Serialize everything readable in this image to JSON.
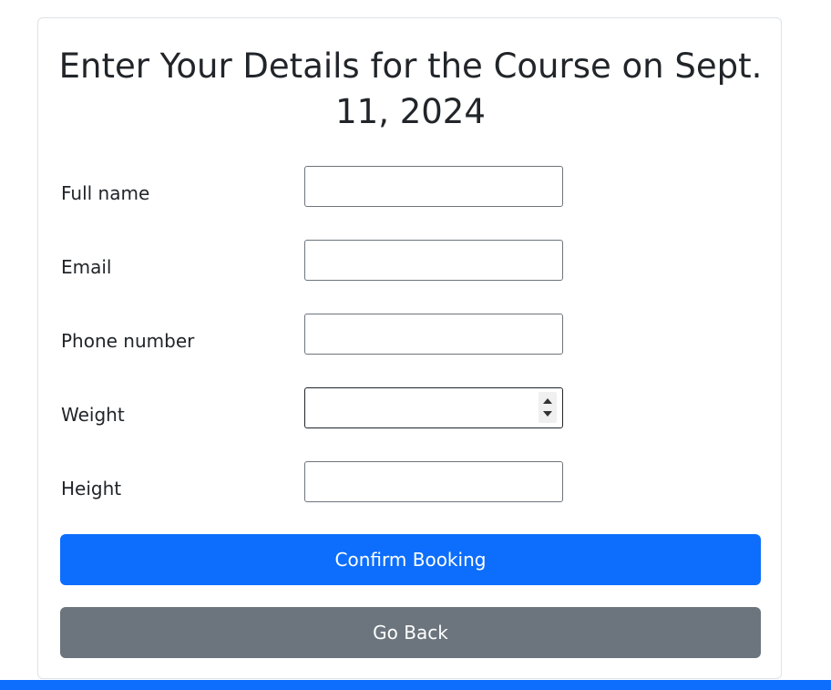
{
  "form": {
    "title": "Enter Your Details for the Course on Sept. 11, 2024",
    "fields": [
      {
        "label": "Full name",
        "value": "",
        "type": "text"
      },
      {
        "label": "Email",
        "value": "",
        "type": "text"
      },
      {
        "label": "Phone number",
        "value": "",
        "type": "text"
      },
      {
        "label": "Weight",
        "value": "",
        "type": "number"
      },
      {
        "label": "Height",
        "value": "",
        "type": "text"
      }
    ],
    "confirm_label": "Confirm Booking",
    "back_label": "Go Back"
  },
  "colors": {
    "primary": "#0d6efd",
    "secondary": "#6c757d",
    "text": "#212529"
  },
  "icons": {
    "weight_spinner": "number-spinner-icon"
  }
}
